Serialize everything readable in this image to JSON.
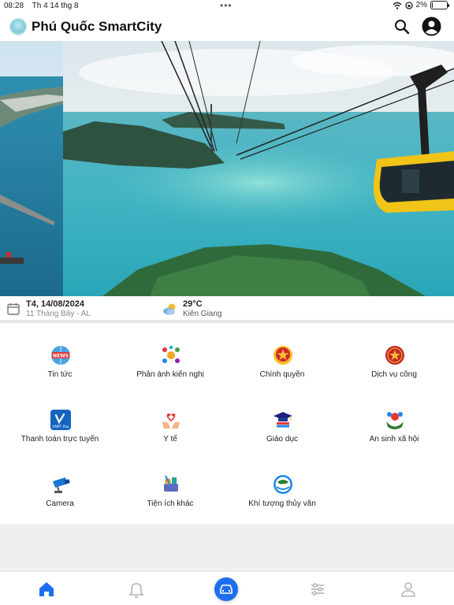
{
  "status_bar": {
    "time": "08:28",
    "date": "Th 4 14 thg 8",
    "dots": "•••",
    "battery_text": "2%",
    "battery_level": 0.02
  },
  "header": {
    "title": "Phú Quốc SmartCity",
    "search_icon": "search-icon",
    "account_icon": "account-circle-icon"
  },
  "info": {
    "date_main": "T4, 14/08/2024",
    "date_lunar": "11 Tháng Bảy - AL",
    "temperature": "29°C",
    "location": "Kiên Giang"
  },
  "services": [
    {
      "label": "Tin tức",
      "icon": "news-icon"
    },
    {
      "label": "Phản ánh kiến nghị",
      "icon": "feedback-icon"
    },
    {
      "label": "Chính quyền",
      "icon": "government-emblem-icon"
    },
    {
      "label": "Dịch vụ công",
      "icon": "public-service-icon"
    },
    {
      "label": "Thanh toán trực tuyến",
      "icon": "vnpt-pay-icon"
    },
    {
      "label": "Y tế",
      "icon": "health-icon"
    },
    {
      "label": "Giáo dục",
      "icon": "education-icon"
    },
    {
      "label": "An sinh xã hội",
      "icon": "social-welfare-icon"
    },
    {
      "label": "Camera",
      "icon": "camera-icon"
    },
    {
      "label": "Tiện ích khác",
      "icon": "utilities-icon"
    },
    {
      "label": "Khí tượng thủy văn",
      "icon": "weather-station-icon"
    }
  ],
  "tabbar": {
    "active_color": "#1e6ff0",
    "inactive_color": "#b5b5b5",
    "tabs": [
      "home-icon",
      "bell-icon",
      "car-icon",
      "sliders-icon",
      "person-icon"
    ]
  }
}
